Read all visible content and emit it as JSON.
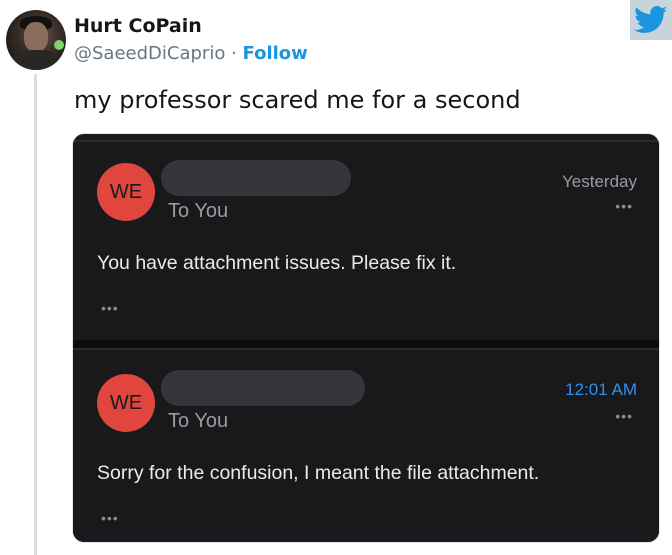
{
  "tweet": {
    "display_name": "Hurt CoPain",
    "handle": "@SaeedDiCaprio",
    "separator": " · ",
    "follow_label": "Follow",
    "text": "my professor scared me for a second"
  },
  "icons": {
    "brand": "twitter-bird-icon",
    "brand_color": "#1b95e0"
  },
  "emails": [
    {
      "avatar_initials": "WE",
      "recipient": "To You",
      "time": "Yesterday",
      "more": "•••",
      "body": "You have attachment issues. Please fix it.",
      "more_bottom": "•••"
    },
    {
      "avatar_initials": "WE",
      "recipient": "To You",
      "time": "12:01 AM",
      "time_color": "#2f8ff0",
      "more": "•••",
      "body": "Sorry for the confusion, I meant the file attachment.",
      "more_bottom": "•••"
    }
  ]
}
